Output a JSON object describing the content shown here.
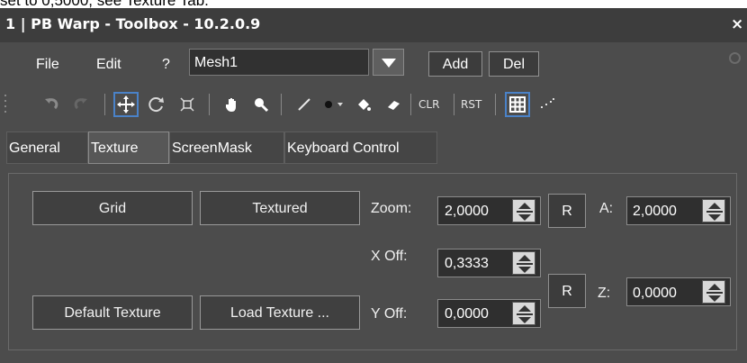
{
  "caption": "set to 0,5000, see Texture Tab.",
  "window": {
    "title": "1 | PB Warp - Toolbox - 10.2.0.9",
    "close_glyph": "×"
  },
  "menu": {
    "file": "File",
    "edit": "Edit",
    "help": "?",
    "mesh_value": "Mesh1",
    "add": "Add",
    "del": "Del"
  },
  "toolbar": {
    "icons": [
      "undo-icon",
      "redo-icon",
      "move-icon",
      "rotate-icon",
      "scale-icon",
      "hand-icon",
      "zoom-icon",
      "line-icon",
      "dot-icon",
      "fill-icon",
      "eraser-icon",
      "grid-icon",
      "points-icon"
    ],
    "clr": "CLR",
    "rst": "RST"
  },
  "tabs": [
    "General",
    "Texture",
    "ScreenMask",
    "Keyboard Control"
  ],
  "active_tab": "Texture",
  "texture": {
    "grid_button": "Grid",
    "textured_button": "Textured",
    "default_texture_button": "Default Texture",
    "load_texture_button": "Load Texture ...",
    "zoom_label": "Zoom:",
    "zoom_value": "2,0000",
    "reset_label": "R",
    "a_label": "A:",
    "a_value": "2,0000",
    "xoff_label": "X Off:",
    "xoff_value": "0,3333",
    "yoff_label": "Y Off:",
    "yoff_value": "0,0000",
    "z_label": "Z:",
    "z_value": "0,0000"
  }
}
